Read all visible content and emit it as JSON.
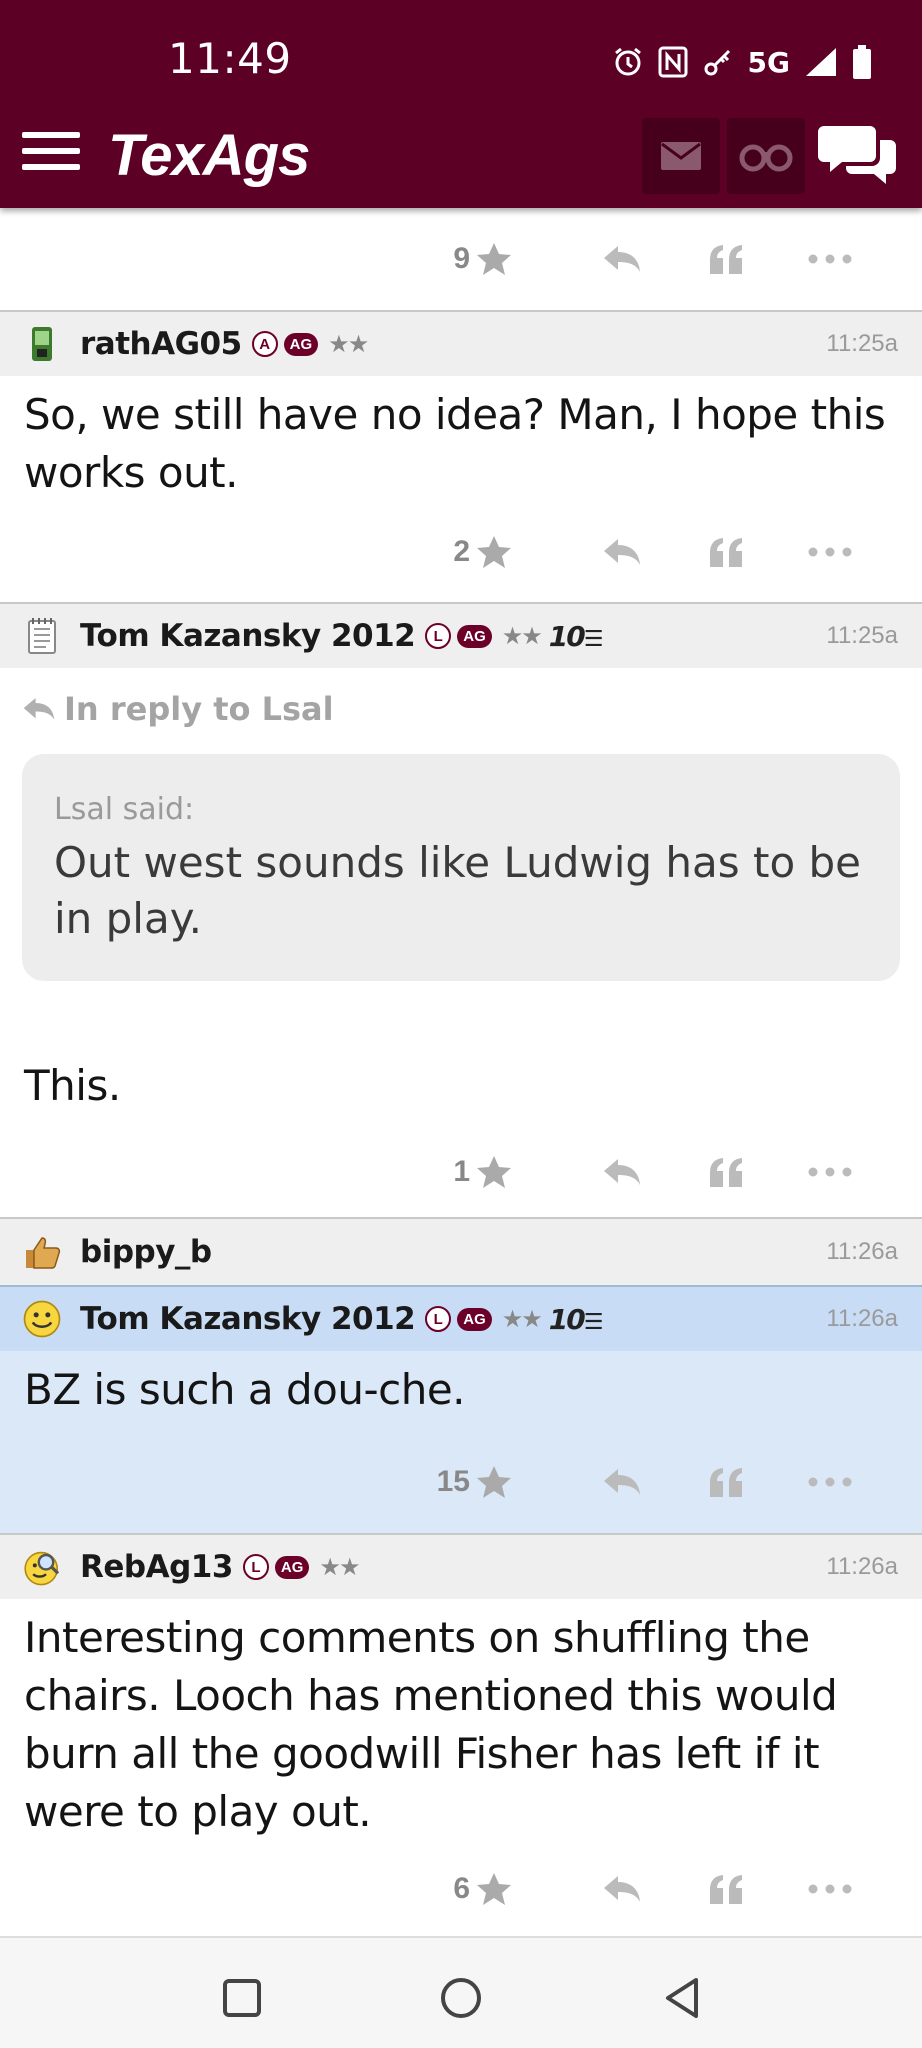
{
  "status_bar": {
    "time": "11:49",
    "network": "5G"
  },
  "app": {
    "logo": "TexAgs"
  },
  "posts": [
    {
      "score": "9"
    },
    {
      "username": "rathAG05",
      "badge": "A",
      "ag_badge": "AG",
      "stars": "★★",
      "time": "11:25a",
      "body": "So, we still have no idea? Man, I hope this works out.",
      "score": "2"
    },
    {
      "username": "Tom Kazansky 2012",
      "badge": "L",
      "ag_badge": "AG",
      "stars": "★★",
      "years": "10",
      "time": "11:25a",
      "reply_to": "In reply to Lsal",
      "quote_author": "Lsal said:",
      "quote_text": "Out west sounds like Ludwig has to be in play.",
      "body": "This.",
      "score": "1"
    },
    {
      "username": "bippy_b",
      "time": "11:26a"
    },
    {
      "username": "Tom Kazansky 2012",
      "badge": "L",
      "ag_badge": "AG",
      "stars": "★★",
      "years": "10",
      "time": "11:26a",
      "body": "BZ is such a dou-che.",
      "score": "15"
    },
    {
      "username": "RebAg13",
      "badge": "L",
      "ag_badge": "AG",
      "stars": "★★",
      "time": "11:26a",
      "body": "Interesting comments on shuffling the chairs. Looch has mentioned this would burn all the goodwill Fisher has left if it were to play out.",
      "score": "6"
    }
  ],
  "colors": {
    "brand": "#5c0025",
    "highlight": "#dbe8f8"
  }
}
